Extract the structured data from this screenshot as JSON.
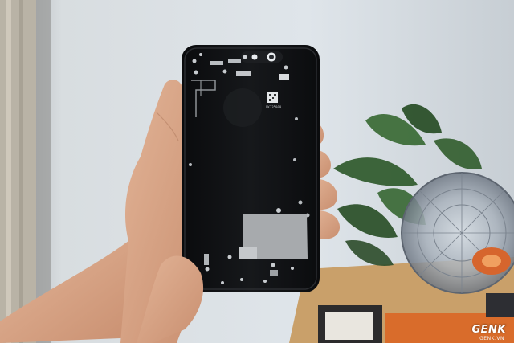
{
  "watermark": {
    "brand": "GENK",
    "site": "GENK.VN"
  },
  "serial": "FK335000",
  "colors": {
    "wall": "#cfd6dc",
    "phone_shell": "#111214",
    "skin": "#d9a888",
    "plant": "#2f5a2c",
    "table": "#c9a06a",
    "shield": "#a7aaad"
  },
  "icons": [
    "hand",
    "phone-shell",
    "plant",
    "desk-fan"
  ]
}
